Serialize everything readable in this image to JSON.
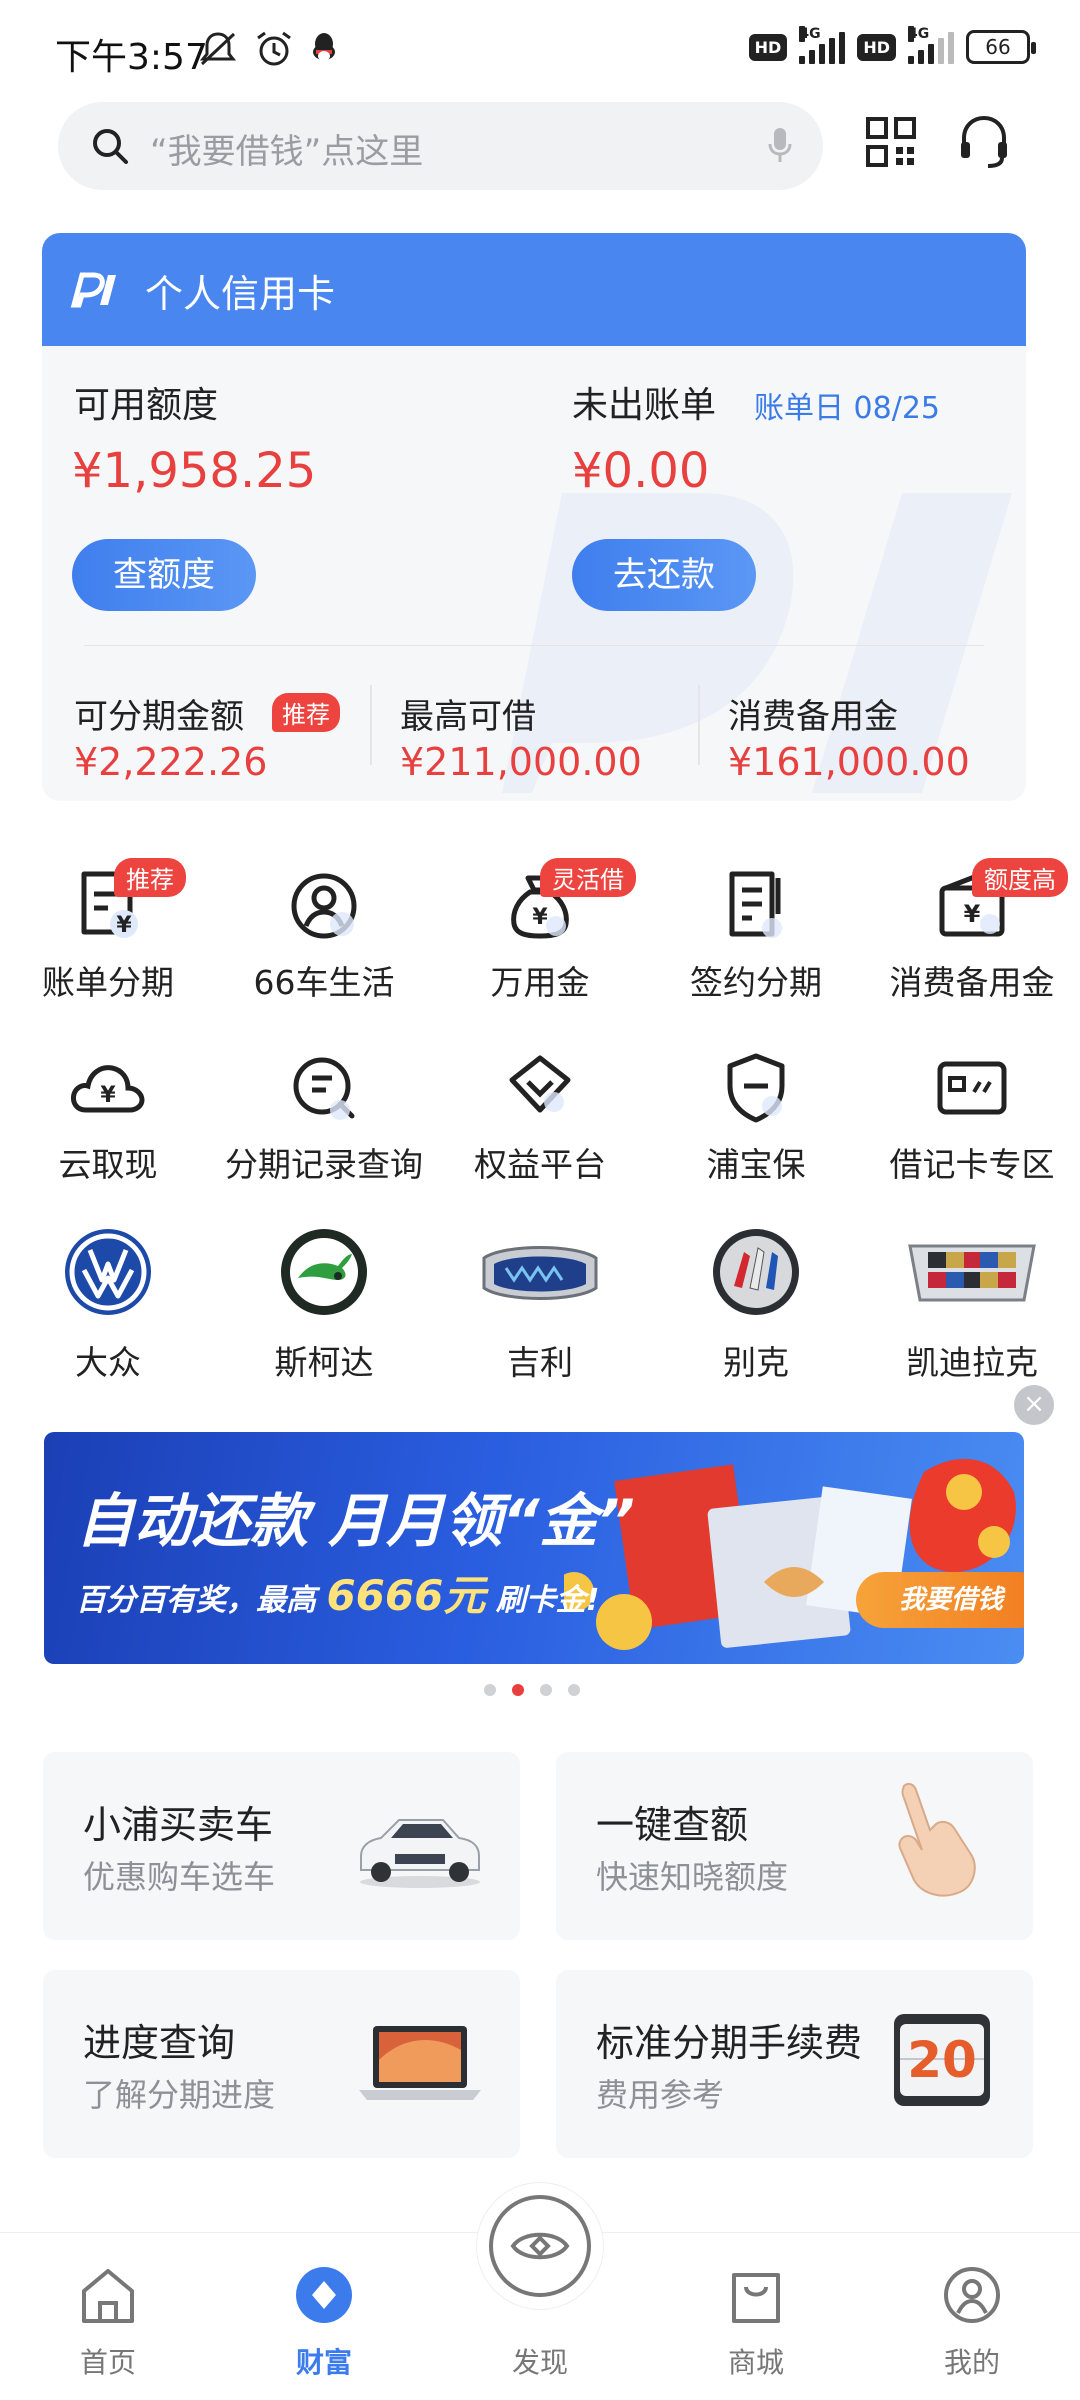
{
  "status_bar": {
    "time": "下午3:57",
    "signal_1": "4G",
    "signal_2": "4G",
    "hd_1": "HD",
    "hd_2": "HD",
    "battery": "66"
  },
  "search": {
    "placeholder": "“我要借钱”点这里"
  },
  "credit_card": {
    "title": "个人信用卡",
    "available_label": "可用额度",
    "available_amount": "¥1,958.25",
    "check_button": "查额度",
    "unbilled_label": "未出账单",
    "bill_day": "账单日 08/25",
    "unbilled_amount": "¥0.00",
    "repay_button": "去还款",
    "installment_label": "可分期金额",
    "installment_badge": "推荐",
    "installment_amount": "¥2,222.26",
    "max_loan_label": "最高可借",
    "max_loan_amount": "¥211,000.00",
    "reserve_label": "消费备用金",
    "reserve_amount": "¥161,000.00"
  },
  "grid": {
    "row1": [
      {
        "label": "账单分期",
        "badge": "推荐",
        "icon": "bill-installment-icon"
      },
      {
        "label": "66车生活",
        "icon": "user-circle-icon"
      },
      {
        "label": "万用金",
        "badge": "灵活借",
        "icon": "money-bag-icon"
      },
      {
        "label": "签约分期",
        "icon": "contract-icon"
      },
      {
        "label": "消费备用金",
        "badge": "额度高",
        "icon": "wallet-icon"
      }
    ],
    "row2": [
      {
        "label": "云取现",
        "icon": "cloud-cash-icon"
      },
      {
        "label": "分期记录查询",
        "icon": "search-record-icon"
      },
      {
        "label": "权益平台",
        "icon": "diamond-icon"
      },
      {
        "label": "浦宝保",
        "icon": "shield-icon"
      },
      {
        "label": "借记卡专区",
        "icon": "card-icon"
      }
    ],
    "row3": [
      {
        "label": "大众",
        "icon": "volkswagen-logo"
      },
      {
        "label": "斯柯达",
        "icon": "skoda-logo"
      },
      {
        "label": "吉利",
        "icon": "geely-logo"
      },
      {
        "label": "别克",
        "icon": "buick-logo"
      },
      {
        "label": "凯迪拉克",
        "icon": "cadillac-logo"
      }
    ]
  },
  "banner": {
    "headline": "自动还款 月月领“金”",
    "sub_prefix": "百分百有奖，最高",
    "sub_amount": "6666元",
    "sub_suffix": "刷卡金!",
    "button": "我要借钱",
    "active_dot": 2,
    "dot_count": 4
  },
  "services": [
    {
      "title": "小浦买卖车",
      "subtitle": "优惠购车选车",
      "icon": "car-icon"
    },
    {
      "title": "一键查额",
      "subtitle": "快速知晓额度",
      "icon": "hand-icon"
    },
    {
      "title": "进度查询",
      "subtitle": "了解分期进度",
      "icon": "laptop-icon"
    },
    {
      "title": "标准分期手续费",
      "subtitle": "费用参考",
      "icon": "calendar-icon",
      "calendar_day": "20"
    }
  ],
  "tabbar": {
    "tabs": [
      {
        "label": "首页",
        "icon": "home-icon"
      },
      {
        "label": "财富",
        "icon": "wealth-icon",
        "active": true
      },
      {
        "label": "发现",
        "icon": "discover-eye-icon"
      },
      {
        "label": "商城",
        "icon": "shopping-bag-icon"
      },
      {
        "label": "我的",
        "icon": "profile-icon"
      }
    ]
  },
  "colors": {
    "accent_blue": "#4a86f0",
    "amount_red": "#e7403f",
    "badge_red": "#ee4440"
  }
}
